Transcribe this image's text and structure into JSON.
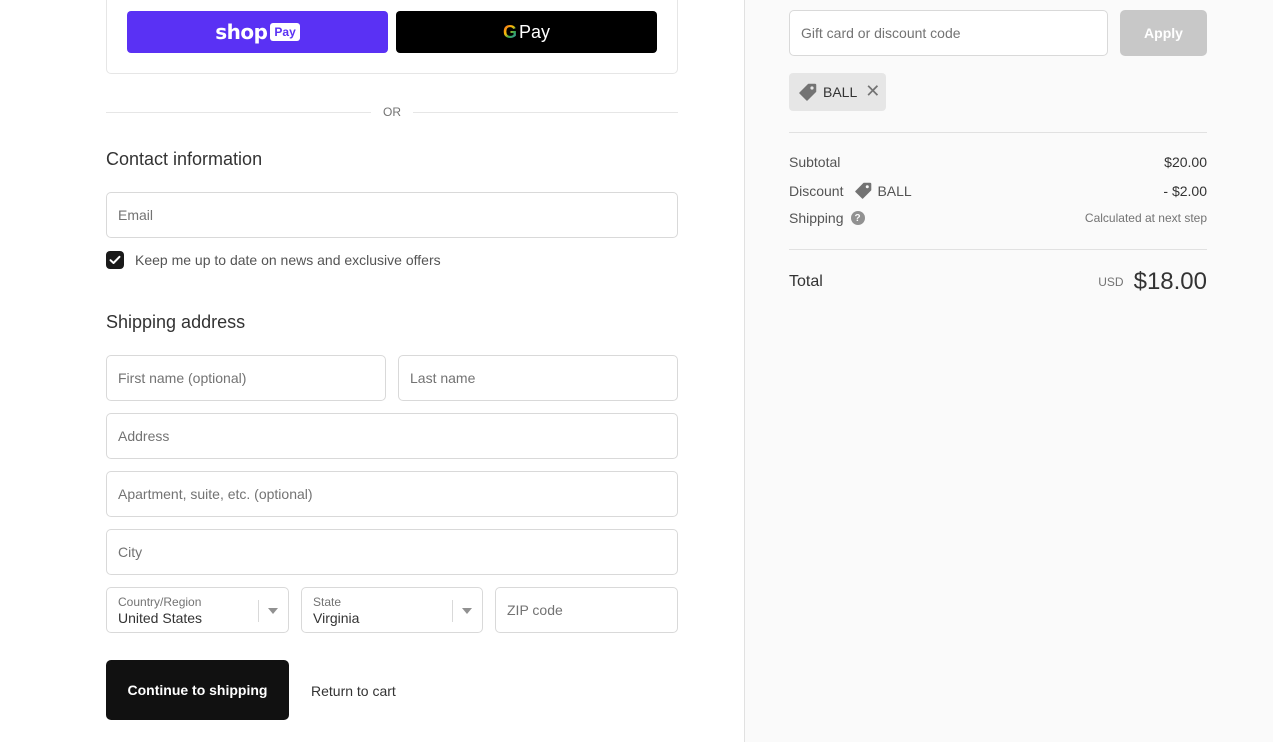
{
  "express_checkout": {
    "shop_pay": {
      "word": "shop",
      "pill": "Pay",
      "color": "#5a31f4"
    },
    "google_pay": {
      "g": "G",
      "word": "Pay",
      "color": "#000000"
    },
    "or_label": "OR"
  },
  "contact": {
    "title": "Contact information",
    "email_placeholder": "Email",
    "email_value": "",
    "newsletter_label": "Keep me up to date on news and exclusive offers",
    "newsletter_checked": true
  },
  "shipping": {
    "title": "Shipping address",
    "first_name_placeholder": "First name (optional)",
    "last_name_placeholder": "Last name",
    "address_placeholder": "Address",
    "apartment_placeholder": "Apartment, suite, etc. (optional)",
    "city_placeholder": "City",
    "country_label": "Country/Region",
    "country_value": "United States",
    "state_label": "State",
    "state_value": "Virginia",
    "zip_placeholder": "ZIP code"
  },
  "actions": {
    "continue_label": "Continue to shipping",
    "return_label": "Return to cart"
  },
  "sidebar": {
    "discount_placeholder": "Gift card or discount code",
    "apply_label": "Apply",
    "applied_code": "BALL",
    "remove_glyph": "✕",
    "subtotal_label": "Subtotal",
    "subtotal_value": "$20.00",
    "discount_label": "Discount",
    "discount_code": "BALL",
    "discount_value": "- $2.00",
    "shipping_label": "Shipping",
    "shipping_help_glyph": "?",
    "shipping_value": "Calculated at next step",
    "total_label": "Total",
    "currency": "USD",
    "total_value": "$18.00"
  }
}
